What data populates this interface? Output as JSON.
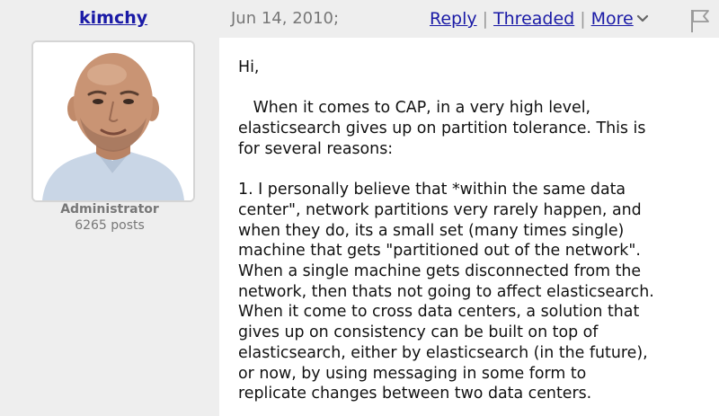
{
  "post": {
    "author": "kimchy",
    "date": "Jun 14, 2010;",
    "actions": {
      "reply": "Reply",
      "threaded": "Threaded",
      "more": "More",
      "separator": "|"
    },
    "profile": {
      "role": "Administrator",
      "posts": "6265 posts"
    },
    "body": "Hi,\n\n   When it comes to CAP, in a very high level,\nelasticsearch gives up on partition tolerance. This is\nfor several reasons:\n\n1. I personally believe that *within the same data\ncenter\", network partitions very rarely happen, and\nwhen they do, its a small set (many times single)\nmachine that gets \"partitioned out of the network\".\nWhen a single machine gets disconnected from the\nnetwork, then thats not going to affect elasticsearch.\nWhen it come to cross data centers, a solution that\ngives up on consistency can be built on top of\nelasticsearch, either by elasticsearch (in the future),\nor now, by using messaging in some form to\nreplicate changes between two data centers."
  },
  "icons": {
    "more": "chevron-down-icon",
    "flag": "flag-icon"
  },
  "colors": {
    "link": "#1a1aa6",
    "meta_text": "#777777",
    "background": "#eeeeee",
    "content_background": "#ffffff"
  }
}
